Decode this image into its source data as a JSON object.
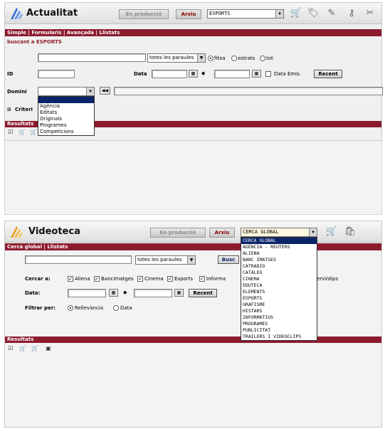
{
  "screen1": {
    "app_title": "Actualitat",
    "production_button": "En producció",
    "archive_button": "Arxiu",
    "collection_value": "ESPORTS",
    "nav_tabs": "Simple | Formularis | Avançada | Llistats",
    "search_heading": "buscant a ESPORTS",
    "words_select": "totes les paraules",
    "match_options": [
      "fitxa",
      "estrats",
      "tot"
    ],
    "id_label": "ID",
    "date_label": "Data",
    "date_emis_label": "Data Emis.",
    "recent_button": "Recent",
    "domain_label": "Domini",
    "domain_options": [
      "",
      "Agència",
      "Editats",
      "Originals",
      "Programes",
      "Competicions"
    ],
    "criteria_label": "Criteri",
    "results_label": "Resultats"
  },
  "screen2": {
    "app_title": "Videoteca",
    "production_button": "En producció",
    "archive_button": "Arxiu",
    "collection_value": "CERCA GLOBAL",
    "collection_options": [
      "CERCA GLOBAL",
      "AGÈNCIA - REUTERS",
      "ALIENA",
      "BANC IMATGES",
      "CATRADIO",
      "CATÀLEG",
      "CINEMA",
      "EDUTECA",
      "ELEMENTS",
      "ESPORTS",
      "GRAFISME",
      "HISTARS",
      "INFORMATIUS",
      "PROGRAMES",
      "PUBLICITAT",
      "TRAILERS I VIDEOCLIPS"
    ],
    "nav_tabs": "Cerca global | Llistats",
    "words_select": "totes les paraules",
    "search_button": "Busc",
    "search_in_label": "Cercar a:",
    "sources": [
      "Aliena",
      "BancImatges",
      "Cinema",
      "Esports",
      "Informa"
    ],
    "trailing_source": "ersVdips",
    "date_label": "Data:",
    "recent_button": "Recent",
    "filter_label": "Filtrar per:",
    "filter_options": [
      "Rellevància",
      "Data"
    ],
    "results_label": "Resultats"
  }
}
